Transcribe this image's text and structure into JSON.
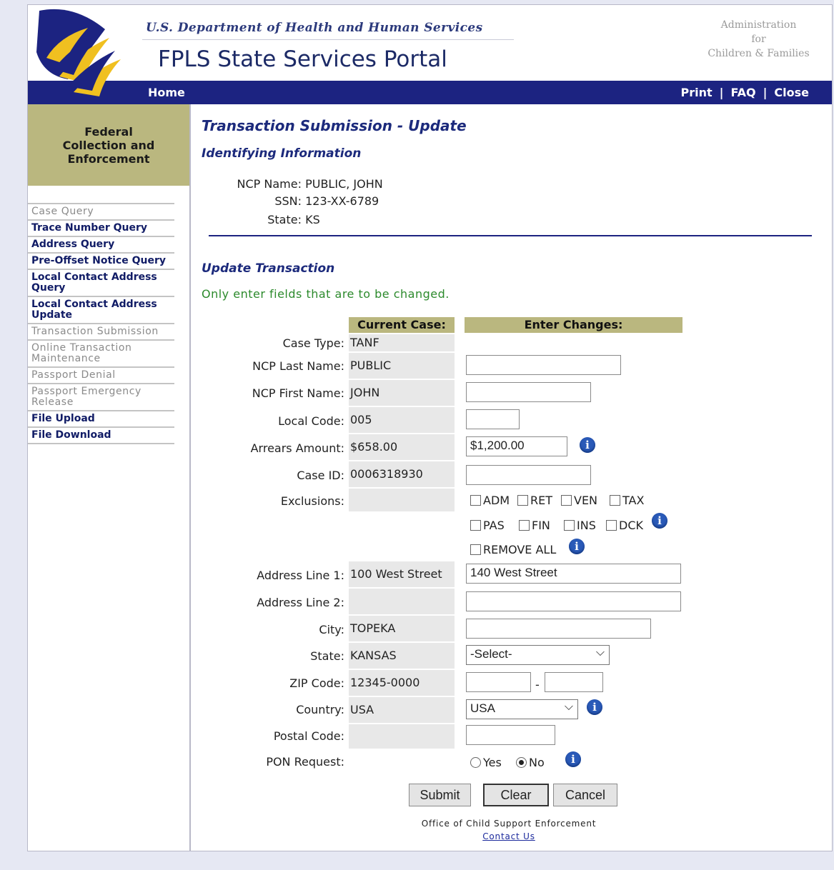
{
  "header": {
    "dept_title": "U.S. Department of Health and Human Services",
    "portal_title": "FPLS State Services Portal",
    "acf_line1": "Administration",
    "acf_line2": "for",
    "acf_line3": "Children & Families"
  },
  "nav": {
    "home": "Home",
    "print": "Print",
    "faq": "FAQ",
    "close": "Close",
    "separator": "|"
  },
  "sidebar": {
    "heading_line1": "Federal",
    "heading_line2": "Collection and",
    "heading_line3": "Enforcement",
    "items": [
      {
        "label": "Case Query",
        "enabled": false
      },
      {
        "label": "Trace Number Query",
        "enabled": true
      },
      {
        "label": "Address Query",
        "enabled": true
      },
      {
        "label": "Pre-Offset Notice Query",
        "enabled": true
      },
      {
        "label": "Local Contact Address Query",
        "enabled": true
      },
      {
        "label": "Local Contact Address Update",
        "enabled": true
      },
      {
        "label": "Transaction Submission",
        "enabled": false
      },
      {
        "label": "Online Transaction Maintenance",
        "enabled": false
      },
      {
        "label": "Passport Denial",
        "enabled": false
      },
      {
        "label": "Passport Emergency Release",
        "enabled": false
      },
      {
        "label": "File Upload",
        "enabled": true
      },
      {
        "label": "File Download",
        "enabled": true
      }
    ]
  },
  "main": {
    "title": "Transaction Submission - Update",
    "identifying_heading": "Identifying Information",
    "ncp_name_label": "NCP Name:",
    "ncp_name_value": "PUBLIC, JOHN",
    "ssn_label": "SSN:",
    "ssn_value": "123-XX-6789",
    "state_label": "State:",
    "state_value": "KS",
    "update_heading": "Update Transaction",
    "note": "Only enter fields that are to be changed.",
    "col_current": "Current Case:",
    "col_changes": "Enter Changes:"
  },
  "form": {
    "case_type_label": "Case Type:",
    "case_type_current": "TANF",
    "last_name_label": "NCP Last Name:",
    "last_name_current": "PUBLIC",
    "last_name_value": "",
    "first_name_label": "NCP First Name:",
    "first_name_current": "JOHN",
    "first_name_value": "",
    "local_code_label": "Local Code:",
    "local_code_current": "005",
    "local_code_value": "",
    "arrears_label": "Arrears Amount:",
    "arrears_current": "$658.00",
    "arrears_value": "$1,200.00",
    "case_id_label": "Case ID:",
    "case_id_current": "0006318930",
    "case_id_value": "",
    "exclusions_label": "Exclusions:",
    "exclusions": [
      "ADM",
      "RET",
      "VEN",
      "TAX",
      "PAS",
      "FIN",
      "INS",
      "DCK"
    ],
    "remove_all": "REMOVE ALL",
    "addr1_label": "Address Line 1:",
    "addr1_current": "100 West Street",
    "addr1_value": "140 West Street",
    "addr2_label": "Address Line 2:",
    "addr2_current": "",
    "addr2_value": "",
    "city_label": "City:",
    "city_current": "TOPEKA",
    "city_value": "",
    "state_label": "State:",
    "state_current": "KANSAS",
    "state_selected": "-Select-",
    "zip_label": "ZIP Code:",
    "zip_current": "12345-0000",
    "zip_dash": "-",
    "country_label": "Country:",
    "country_current": "USA",
    "country_selected": "USA",
    "postal_label": "Postal Code:",
    "postal_value": "",
    "pon_label": "PON Request:",
    "pon_yes": "Yes",
    "pon_no": "No",
    "pon_selected": "No"
  },
  "buttons": {
    "submit": "Submit",
    "clear": "Clear",
    "cancel": "Cancel"
  },
  "footer": {
    "org": "Office of Child Support Enforcement",
    "contact": "Contact Us"
  },
  "colors": {
    "nav_bar": "#1c2381",
    "header_band": "#bab77f",
    "heading_text": "#1c2a7c",
    "note_text": "#2c8a2c",
    "info_icon": "#2a5ab8"
  }
}
